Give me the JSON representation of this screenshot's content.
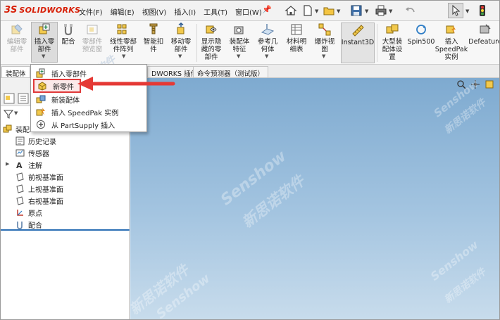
{
  "app": {
    "logo_mark": "3S",
    "logo_text": "SOLIDWORKS"
  },
  "menu": {
    "items": [
      "文件(F)",
      "编辑(E)",
      "视图(V)",
      "插入(I)",
      "工具(T)",
      "窗口(W)"
    ],
    "pin_icon": "pin-icon"
  },
  "quick_access": {
    "icons": [
      "home-icon",
      "new-document-icon",
      "open-folder-icon",
      "save-icon",
      "print-icon",
      "select-arrow-icon",
      "traffic-light-icon"
    ]
  },
  "ribbon": {
    "buttons": [
      {
        "label": "编辑零\n部件",
        "icon": "edit-component-icon",
        "enabled": false
      },
      {
        "label": "插入零\n部件",
        "icon": "insert-component-icon",
        "enabled": true
      },
      {
        "label": "配合",
        "icon": "mate-icon",
        "enabled": true
      },
      {
        "label": "零部件\n预览窗",
        "icon": "component-preview-icon",
        "enabled": false
      },
      {
        "label": "线性零部\n件阵列",
        "icon": "linear-pattern-icon",
        "enabled": true
      },
      {
        "label": "智能扣\n件",
        "icon": "smart-fastener-icon",
        "enabled": true
      },
      {
        "label": "移动零\n部件",
        "icon": "move-component-icon",
        "enabled": true
      },
      {
        "label": "显示隐\n藏的零\n部件",
        "icon": "show-hidden-icon",
        "enabled": true
      },
      {
        "label": "装配体\n特征",
        "icon": "assembly-feature-icon",
        "enabled": true
      },
      {
        "label": "参考几\n何体",
        "icon": "reference-geometry-icon",
        "enabled": true
      },
      {
        "label": "材料明\n细表",
        "icon": "bom-icon",
        "enabled": true
      },
      {
        "label": "爆炸视\n图",
        "icon": "exploded-view-icon",
        "enabled": true
      },
      {
        "label": "Instant3D",
        "icon": "instant3d-icon",
        "enabled": true
      },
      {
        "label": "大型装\n配体设\n置",
        "icon": "large-assembly-icon",
        "enabled": true
      },
      {
        "label": "Spin500",
        "icon": "spin500-icon",
        "enabled": true
      },
      {
        "label": "插入\nSpeedPak\n实例",
        "icon": "speedpak-icon",
        "enabled": true
      },
      {
        "label": "Defeature",
        "icon": "defeature-icon",
        "enabled": true
      }
    ]
  },
  "tabs": {
    "first": "装配体",
    "addins": "DWORKS 插件",
    "predictor": "命令预测器（测试版）"
  },
  "flyout": {
    "items": [
      {
        "label": "插入零部件",
        "icon": "insert-component-icon"
      },
      {
        "label": "新零件",
        "icon": "new-part-icon"
      },
      {
        "label": "新装配体",
        "icon": "new-assembly-icon"
      },
      {
        "label": "插入 SpeedPak 实例",
        "icon": "speedpak-icon"
      },
      {
        "label": "从 PartSupply 插入",
        "icon": "partsupply-icon"
      }
    ],
    "highlighted_index": 1
  },
  "tree": {
    "root": "装配",
    "items": [
      {
        "label": "历史记录",
        "icon": "history-icon"
      },
      {
        "label": "传感器",
        "icon": "sensor-icon"
      },
      {
        "label": "注解",
        "icon": "annotation-icon"
      },
      {
        "label": "前视基准面",
        "icon": "plane-icon"
      },
      {
        "label": "上视基准面",
        "icon": "plane-icon"
      },
      {
        "label": "右视基准面",
        "icon": "plane-icon"
      },
      {
        "label": "原点",
        "icon": "origin-icon"
      },
      {
        "label": "配合",
        "icon": "mates-folder-icon"
      }
    ]
  },
  "watermark": {
    "brand_en": "Senshow",
    "brand_cn": "新思诺软件"
  },
  "colors": {
    "accent_red": "#e03a3a",
    "brand_red": "#d81e05",
    "viewport_top": "#7eaad0",
    "viewport_bottom": "#c8dcec",
    "tree_rule": "#2c6fb4"
  }
}
